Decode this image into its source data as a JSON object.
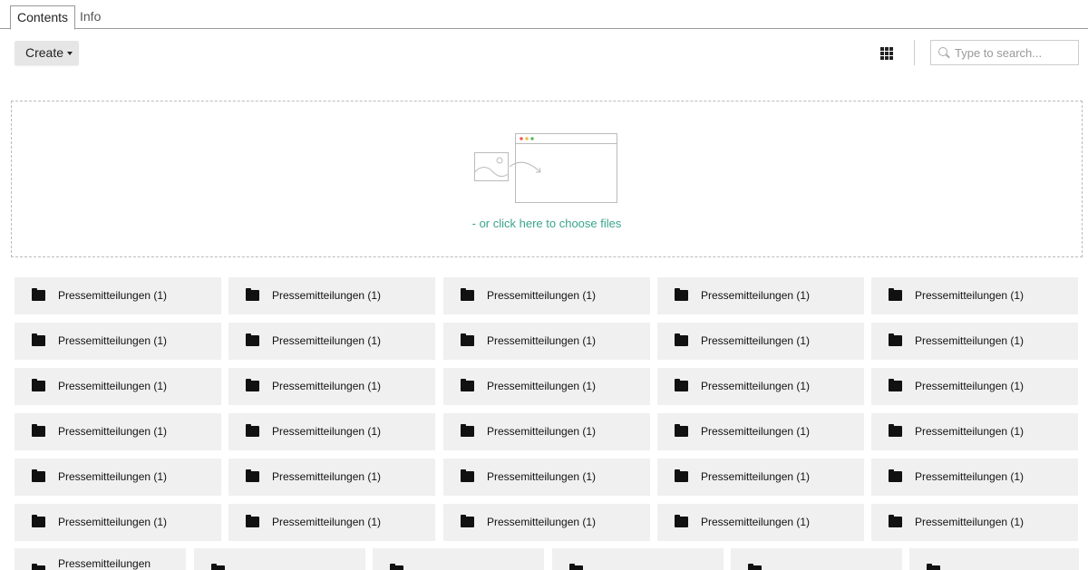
{
  "tabs": [
    {
      "label": "Contents",
      "active": true
    },
    {
      "label": "Info",
      "active": false
    }
  ],
  "toolbar": {
    "create_label": "Create",
    "view_icon": "grid-icon",
    "search_placeholder": "Type to search..."
  },
  "dropzone": {
    "choose_text": "- or click here to choose files"
  },
  "colors": {
    "accent": "#3aa58a",
    "tile_bg": "#f0f0f1"
  },
  "folders": [
    [
      "Pressemitteilungen (1)",
      "Pressemitteilungen (1)",
      "Pressemitteilungen (1)",
      "Pressemitteilungen (1)",
      "Pressemitteilungen (1)"
    ],
    [
      "Pressemitteilungen (1)",
      "Pressemitteilungen (1)",
      "Pressemitteilungen (1)",
      "Pressemitteilungen (1)",
      "Pressemitteilungen (1)"
    ],
    [
      "Pressemitteilungen (1)",
      "Pressemitteilungen (1)",
      "Pressemitteilungen (1)",
      "Pressemitteilungen (1)",
      "Pressemitteilungen (1)"
    ],
    [
      "Pressemitteilungen (1)",
      "Pressemitteilungen (1)",
      "Pressemitteilungen (1)",
      "Pressemitteilungen (1)",
      "Pressemitteilungen (1)"
    ],
    [
      "Pressemitteilungen (1)",
      "Pressemitteilungen (1)",
      "Pressemitteilungen (1)",
      "Pressemitteilungen (1)",
      "Pressemitteilungen (1)"
    ],
    [
      "Pressemitteilungen (1)",
      "Pressemitteilungen (1)",
      "Pressemitteilungen (1)",
      "Pressemitteilungen (1)",
      "Pressemitteilungen (1)"
    ]
  ],
  "partial_folders": [
    "Pressemitteilungen",
    "",
    "",
    "",
    "",
    ""
  ]
}
